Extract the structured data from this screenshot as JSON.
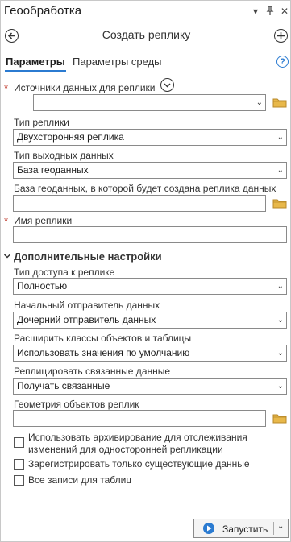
{
  "window": {
    "title": "Геообработка",
    "controls": {
      "menu": "▾",
      "pin": "📌",
      "close": "✕"
    }
  },
  "header": {
    "title": "Создать реплику",
    "back_icon": "arrow-left-circle-icon",
    "add_icon": "plus-circle-icon"
  },
  "tabs": [
    {
      "label": "Параметры",
      "active": true
    },
    {
      "label": "Параметры среды",
      "active": false
    }
  ],
  "help_label": "?",
  "params": {
    "sources": {
      "label": "Источники данных для реплики",
      "required": true,
      "value": ""
    },
    "replica_type": {
      "label": "Тип реплики",
      "value": "Двухсторонняя реплика"
    },
    "output_type": {
      "label": "Тип выходных данных",
      "value": "База геоданных"
    },
    "geodatabase": {
      "label": "База геоданных, в которой будет создана реплика данных",
      "value": ""
    },
    "replica_name": {
      "label": "Имя реплики",
      "required": true,
      "value": ""
    }
  },
  "advanced": {
    "title": "Дополнительные настройки",
    "access_type": {
      "label": "Тип доступа к реплике",
      "value": "Полностью"
    },
    "sender": {
      "label": "Начальный отправитель данных",
      "value": "Дочерний отправитель данных"
    },
    "expand": {
      "label": "Расширить классы объектов и таблицы",
      "value": "Использовать значения по умолчанию"
    },
    "related": {
      "label": "Реплицировать связанные данные",
      "value": "Получать связанные"
    },
    "geometry": {
      "label": "Геометрия объектов реплик",
      "value": ""
    },
    "checkboxes": [
      {
        "label1": "Использовать архивирование для отслеживания",
        "label2": "изменений для односторонней репликации",
        "checked": false
      },
      {
        "label1": "Зарегистрировать только существующие данные",
        "checked": false
      },
      {
        "label1": "Все записи для таблиц",
        "checked": false
      }
    ]
  },
  "footer": {
    "run_label": "Запустить"
  },
  "colors": {
    "accent": "#2b7bd1",
    "required": "#c0392b",
    "folder": "#e8b84a"
  }
}
